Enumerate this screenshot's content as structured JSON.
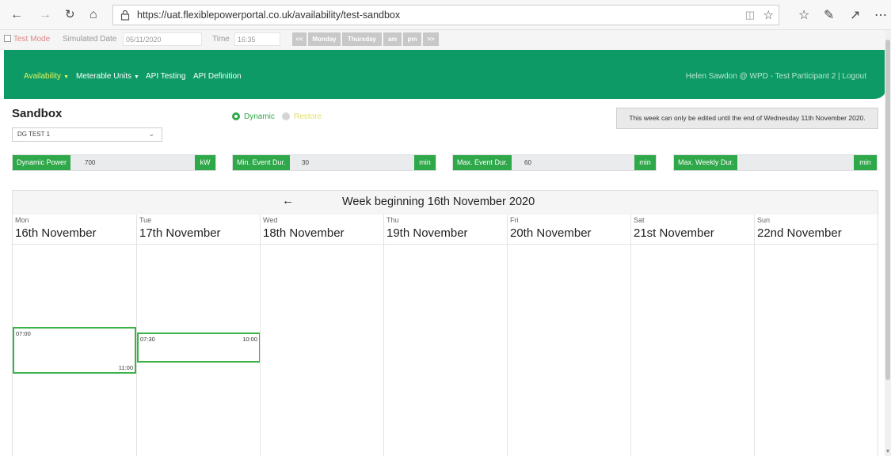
{
  "browser": {
    "url": "https://uat.flexiblepowerportal.co.uk/availability/test-sandbox"
  },
  "test_bar": {
    "test_mode_label": "Test Mode",
    "simulated_date_label": "Simulated Date",
    "simulated_date_value": "05/11/2020",
    "time_label": "Time",
    "time_value": "16:35",
    "buttons": [
      "<<",
      "Monday",
      "Thursday",
      "am",
      "pm",
      ">>"
    ]
  },
  "header": {
    "nav": [
      {
        "label": "Availability",
        "has_dropdown": true,
        "active": true
      },
      {
        "label": "Meterable Units",
        "has_dropdown": true,
        "active": false
      },
      {
        "label": "API Testing",
        "has_dropdown": false,
        "active": false
      },
      {
        "label": "API Definition",
        "has_dropdown": false,
        "active": false
      }
    ],
    "user_info": "Helen Sawdon @ WPD - Test Participant 2 | Logout"
  },
  "page": {
    "title": "Sandbox",
    "unit_select": "DG TEST 1",
    "mode_options": [
      {
        "label": "Dynamic",
        "selected": true
      },
      {
        "label": "Restore",
        "selected": false
      }
    ],
    "notice": "This week can only be edited until the end of Wednesday 11th November 2020."
  },
  "params": [
    {
      "label": "Dynamic Power",
      "value": "700",
      "unit": "kW"
    },
    {
      "label": "Min. Event Dur.",
      "value": "30",
      "unit": "min"
    },
    {
      "label": "Max. Event Dur.",
      "value": "60",
      "unit": "min"
    },
    {
      "label": "Max. Weekly Dur.",
      "value": "",
      "unit": "min"
    }
  ],
  "calendar": {
    "back_arrow": "←",
    "title": "Week beginning 16th November 2020",
    "days": [
      {
        "name": "Mon",
        "date": "16th November"
      },
      {
        "name": "Tue",
        "date": "17th November"
      },
      {
        "name": "Wed",
        "date": "18th November"
      },
      {
        "name": "Thu",
        "date": "19th November"
      },
      {
        "name": "Fri",
        "date": "20th November"
      },
      {
        "name": "Sat",
        "date": "21st November"
      },
      {
        "name": "Sun",
        "date": "22nd November"
      }
    ],
    "events": [
      {
        "day": "Mon",
        "start": "07:00",
        "end": "11:00"
      },
      {
        "day": "Tue",
        "start": "07:30",
        "end": "10:00"
      }
    ]
  },
  "colors": {
    "header_green": "#0d9a66",
    "button_green": "#2fa84a",
    "active_nav": "#e6f35a",
    "event_border": "#3bb34a"
  }
}
